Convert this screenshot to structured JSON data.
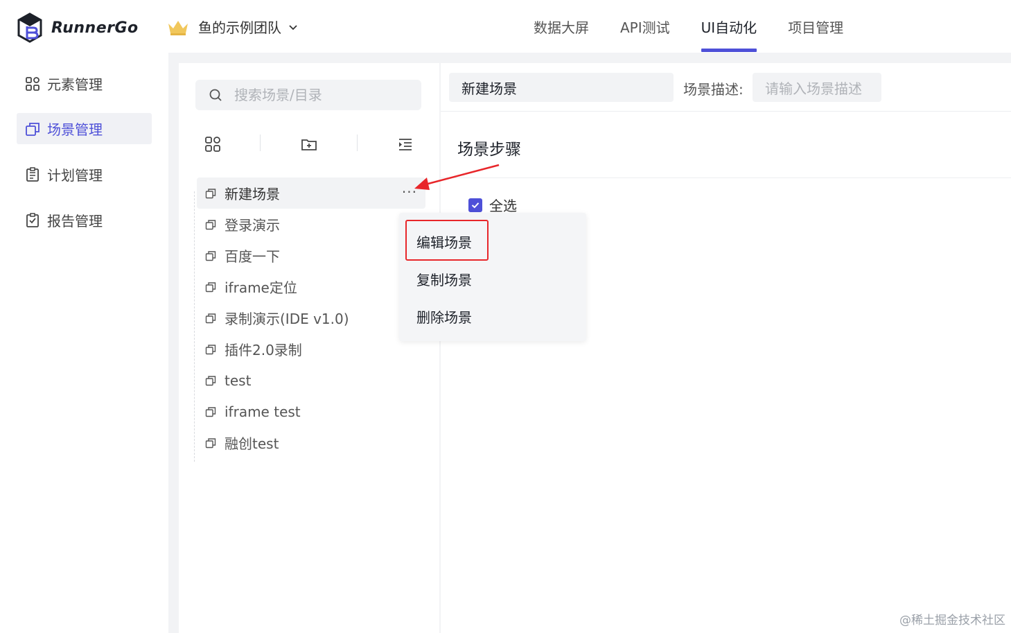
{
  "header": {
    "logo_text": "RunnerGo",
    "team_name": "鱼的示例团队",
    "nav": [
      {
        "label": "数据大屏",
        "active": false
      },
      {
        "label": "API测试",
        "active": false
      },
      {
        "label": "UI自动化",
        "active": true
      },
      {
        "label": "项目管理",
        "active": false
      }
    ]
  },
  "sidebar": {
    "items": [
      {
        "label": "元素管理",
        "icon": "grid-icon",
        "active": false
      },
      {
        "label": "场景管理",
        "icon": "scene-icon",
        "active": true
      },
      {
        "label": "计划管理",
        "icon": "plan-icon",
        "active": false
      },
      {
        "label": "报告管理",
        "icon": "report-icon",
        "active": false
      }
    ]
  },
  "tree": {
    "search_placeholder": "搜索场景/目录",
    "items": [
      {
        "label": "新建场景"
      },
      {
        "label": "登录演示"
      },
      {
        "label": "百度一下"
      },
      {
        "label": "iframe定位"
      },
      {
        "label": "录制演示(IDE v1.0)"
      },
      {
        "label": "插件2.0录制"
      },
      {
        "label": "test"
      },
      {
        "label": "iframe test"
      },
      {
        "label": "融创test"
      }
    ],
    "more_label": "···"
  },
  "context_menu": {
    "items": [
      {
        "label": "编辑场景"
      },
      {
        "label": "复制场景"
      },
      {
        "label": "删除场景"
      }
    ]
  },
  "main": {
    "scene_name": "新建场景",
    "desc_label": "场景描述:",
    "desc_placeholder": "请输入场景描述",
    "steps_title": "场景步骤",
    "select_all_label": "全选",
    "select_all_checked": true
  },
  "colors": {
    "accent": "#4e50d8",
    "highlight": "#e8262a"
  },
  "watermark": "@稀土掘金技术社区"
}
